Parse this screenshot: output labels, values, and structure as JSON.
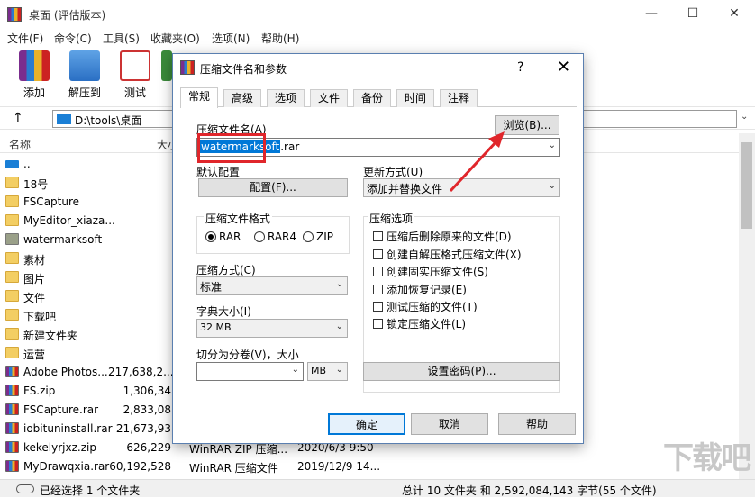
{
  "window": {
    "title": "桌面 (评估版本)",
    "minimize": "—",
    "maximize": "☐",
    "close": "✕"
  },
  "menu": [
    "文件(F)",
    "命令(C)",
    "工具(S)",
    "收藏夹(O)",
    "选项(N)",
    "帮助(H)"
  ],
  "toolbar": [
    "添加",
    "解压到",
    "测试"
  ],
  "address": {
    "up": "↑",
    "path": "D:\\tools\\桌面",
    "drop": "⌄"
  },
  "list": {
    "headers": {
      "name": "名称",
      "size": "大小"
    },
    "files": [
      {
        "name": "..",
        "icon": "up",
        "size": "",
        "type": "",
        "date": ""
      },
      {
        "name": "18号",
        "icon": "folder",
        "size": "",
        "type": "",
        "date": ""
      },
      {
        "name": "FSCapture",
        "icon": "folder",
        "size": "",
        "type": "",
        "date": ""
      },
      {
        "name": "MyEditor_xiaza...",
        "icon": "folder",
        "size": "",
        "type": "",
        "date": ""
      },
      {
        "name": "watermarksoft",
        "icon": "gray",
        "size": "",
        "type": "",
        "date": ""
      },
      {
        "name": "素材",
        "icon": "folder",
        "size": "",
        "type": "",
        "date": ""
      },
      {
        "name": "图片",
        "icon": "folder",
        "size": "",
        "type": "",
        "date": ""
      },
      {
        "name": "文件",
        "icon": "folder",
        "size": "",
        "type": "",
        "date": ""
      },
      {
        "name": "下载吧",
        "icon": "folder",
        "size": "",
        "type": "",
        "date": ""
      },
      {
        "name": "新建文件夹",
        "icon": "folder",
        "size": "",
        "type": "",
        "date": ""
      },
      {
        "name": "运营",
        "icon": "folder",
        "size": "",
        "type": "",
        "date": ""
      },
      {
        "name": "Adobe Photos...",
        "icon": "rar",
        "size": "217,638,2...",
        "type": "",
        "date": ""
      },
      {
        "name": "FS.zip",
        "icon": "rar",
        "size": "1,306,34",
        "type": "",
        "date": ""
      },
      {
        "name": "FSCapture.rar",
        "icon": "rar",
        "size": "2,833,08",
        "type": "",
        "date": ""
      },
      {
        "name": "iobituninstall.rar",
        "icon": "rar",
        "size": "21,673,93",
        "type": "",
        "date": ""
      },
      {
        "name": "kekelyrjxz.zip",
        "icon": "rar",
        "size": "626,229",
        "type": "WinRAR ZIP 压缩...",
        "date": "2020/6/3 9:50"
      },
      {
        "name": "MyDrawqxia.rar",
        "icon": "rar",
        "size": "60,192,528",
        "type": "WinRAR 压缩文件",
        "date": "2019/12/9 14..."
      }
    ]
  },
  "status": {
    "left": "已经选择 1 个文件夹",
    "right": "总计 10 文件夹 和 2,592,084,143 字节(55 个文件)"
  },
  "watermark": "下载吧",
  "dialog": {
    "title": "压缩文件名和参数",
    "help": "?",
    "close": "✕",
    "tabs": [
      "常规",
      "高级",
      "选项",
      "文件",
      "备份",
      "时间",
      "注释"
    ],
    "archive_name_label": "压缩文件名(A)",
    "browse": "浏览(B)...",
    "archive_name_selected": "watermarksoft",
    "archive_name_rest": ".rar",
    "default_profile_label": "默认配置",
    "profile_button": "配置(F)...",
    "update_mode_label": "更新方式(U)",
    "update_mode_value": "添加并替换文件",
    "format_label": "压缩文件格式",
    "formats": [
      "RAR",
      "RAR4",
      "ZIP"
    ],
    "selected_format": "RAR",
    "method_label": "压缩方式(C)",
    "method_value": "标准",
    "dict_label": "字典大小(I)",
    "dict_value": "32 MB",
    "split_label": "切分为分卷(V)，大小",
    "split_value": "",
    "split_unit": "MB",
    "options_label": "压缩选项",
    "options": [
      "压缩后删除原来的文件(D)",
      "创建自解压格式压缩文件(X)",
      "创建固实压缩文件(S)",
      "添加恢复记录(E)",
      "测试压缩的文件(T)",
      "锁定压缩文件(L)"
    ],
    "password_button": "设置密码(P)...",
    "ok": "确定",
    "cancel": "取消",
    "help_button": "帮助"
  },
  "colors": {
    "accent": "#0078d7",
    "highlight": "#e0262b"
  }
}
